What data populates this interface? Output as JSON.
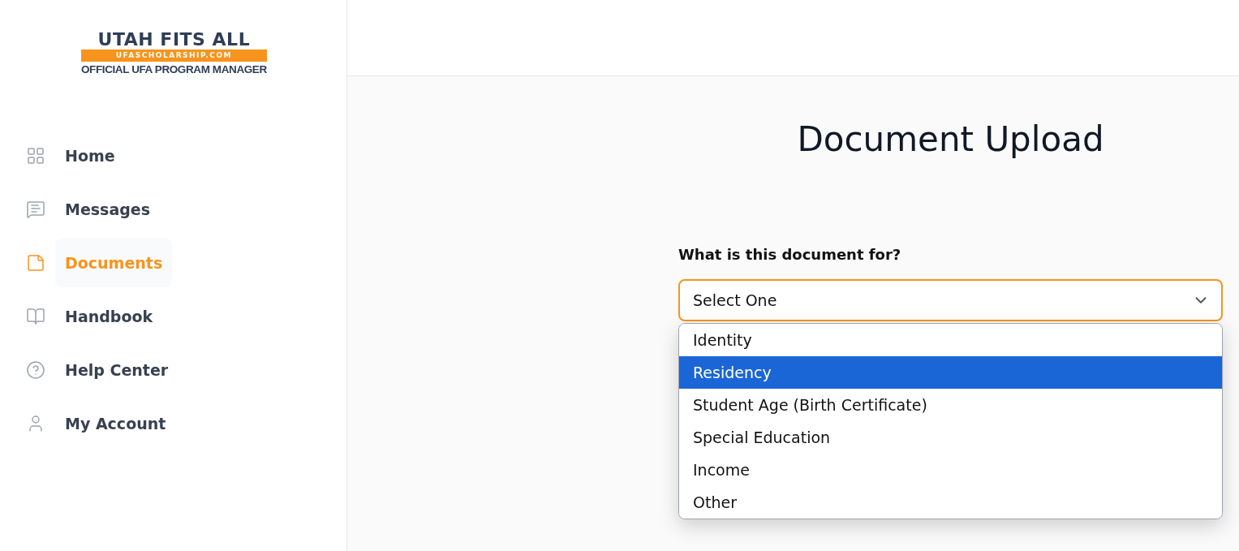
{
  "logo": {
    "title": "UTAH FITS ALL",
    "website": "UFASCHOLARSHIP.COM",
    "tagline": "OFFICIAL UFA PROGRAM MANAGER"
  },
  "sidebar": {
    "items": [
      {
        "label": "Home",
        "selected": false
      },
      {
        "label": "Messages",
        "selected": false
      },
      {
        "label": "Documents",
        "selected": true
      },
      {
        "label": "Handbook",
        "selected": false
      },
      {
        "label": "Help Center",
        "selected": false
      },
      {
        "label": "My Account",
        "selected": false
      }
    ]
  },
  "page": {
    "title": "Document Upload",
    "field": {
      "label": "What is this document for?",
      "value": "Select One",
      "expanded": true,
      "options": [
        {
          "label": "Identity",
          "selected": false
        },
        {
          "label": "Residency",
          "selected": true
        },
        {
          "label": "Student Age (Birth Certificate)",
          "selected": false
        },
        {
          "label": "Special Education",
          "selected": false
        },
        {
          "label": "Income",
          "selected": false
        },
        {
          "label": "Other",
          "selected": false
        }
      ]
    }
  }
}
